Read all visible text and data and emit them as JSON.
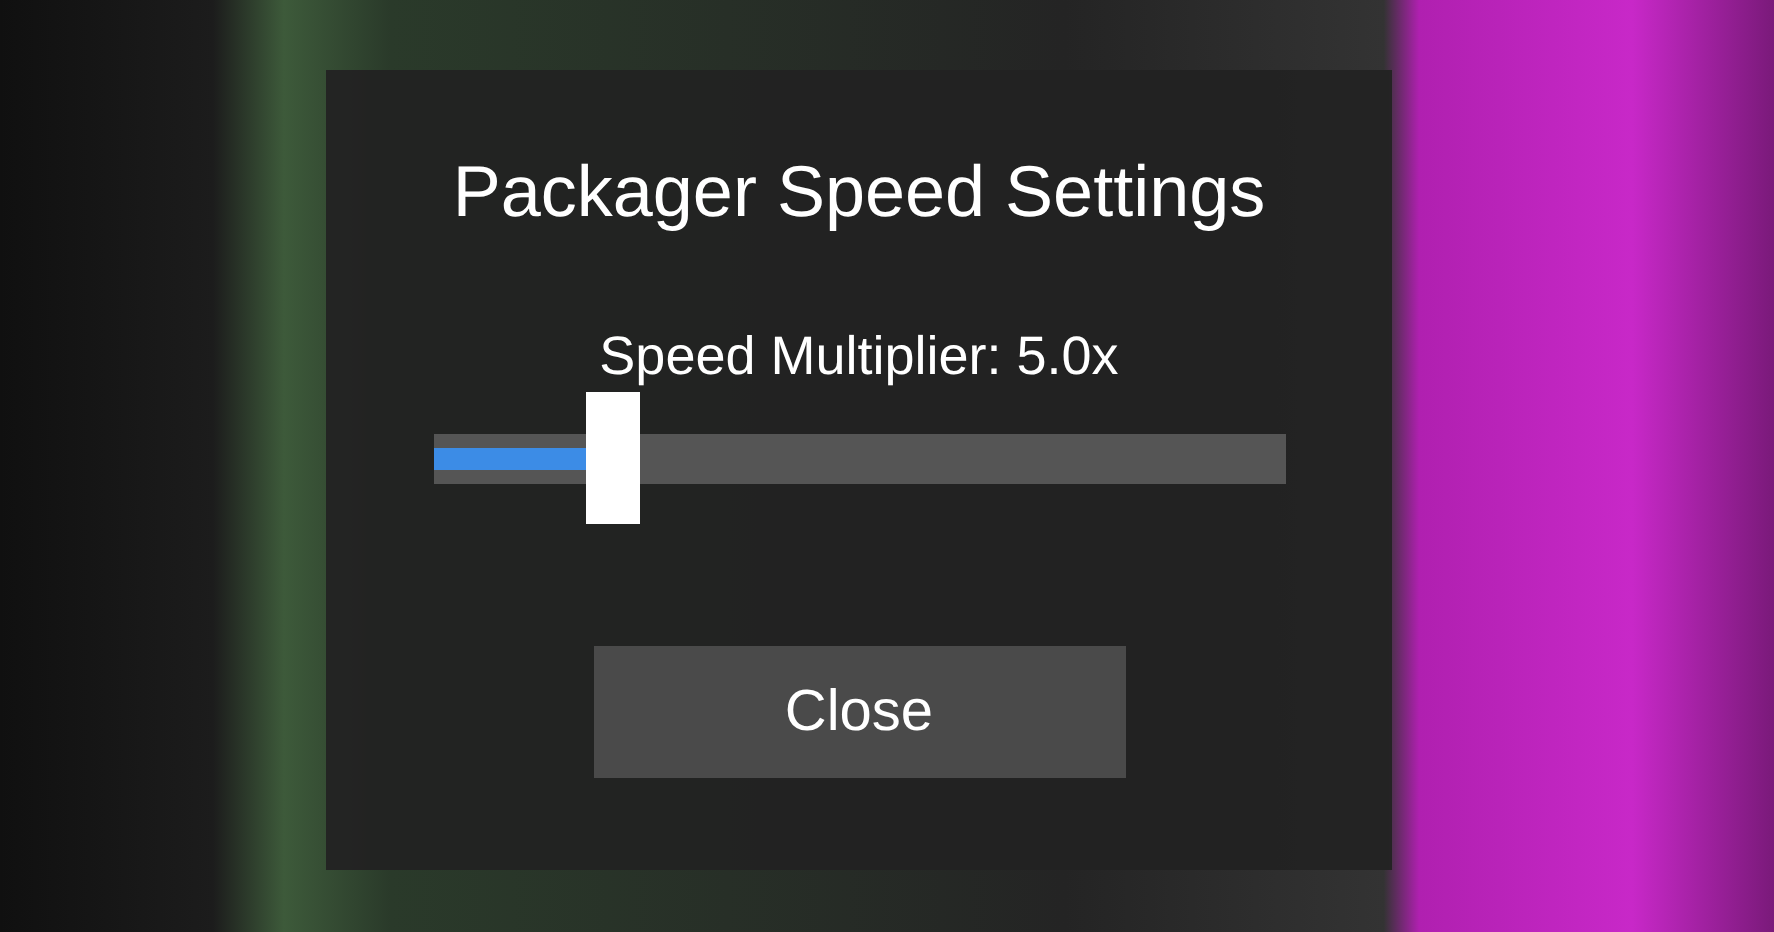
{
  "dialog": {
    "title": "Packager Speed Settings",
    "slider": {
      "label": "Speed Multiplier: 5.0x",
      "level": 0.21
    },
    "buttons": [
      "Close"
    ]
  }
}
